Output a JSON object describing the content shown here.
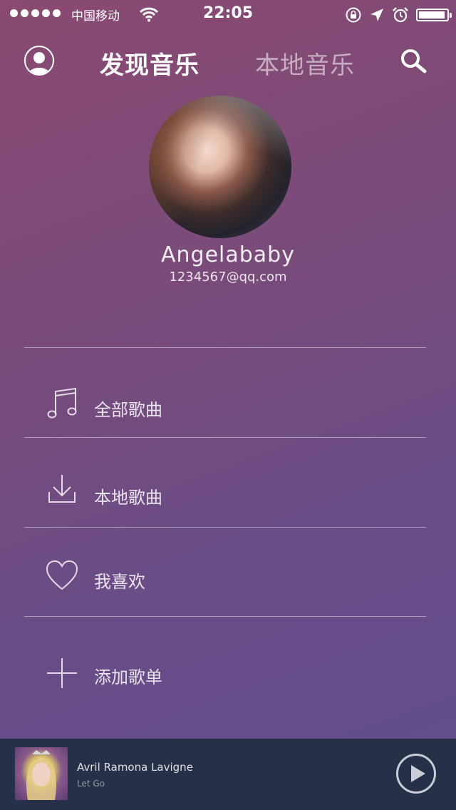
{
  "status_bar": {
    "carrier": "中国移动",
    "time": "22:05"
  },
  "nav": {
    "tab_discover": "发现音乐",
    "tab_local": "本地音乐"
  },
  "profile": {
    "name": "Angelababy",
    "email": "1234567@qq.com"
  },
  "menu": [
    {
      "label": "全部歌曲",
      "icon": "music-note-icon"
    },
    {
      "label": "本地歌曲",
      "icon": "download-icon"
    },
    {
      "label": "我喜欢",
      "icon": "heart-icon"
    },
    {
      "label": "添加歌单",
      "icon": "plus-icon"
    }
  ],
  "player": {
    "artist": "Avril Ramona Lavigne",
    "song": "Let Go"
  },
  "colors": {
    "background_top": "#8a4a72",
    "background_bottom": "#5f4e8f",
    "player_bar": "#263048"
  }
}
